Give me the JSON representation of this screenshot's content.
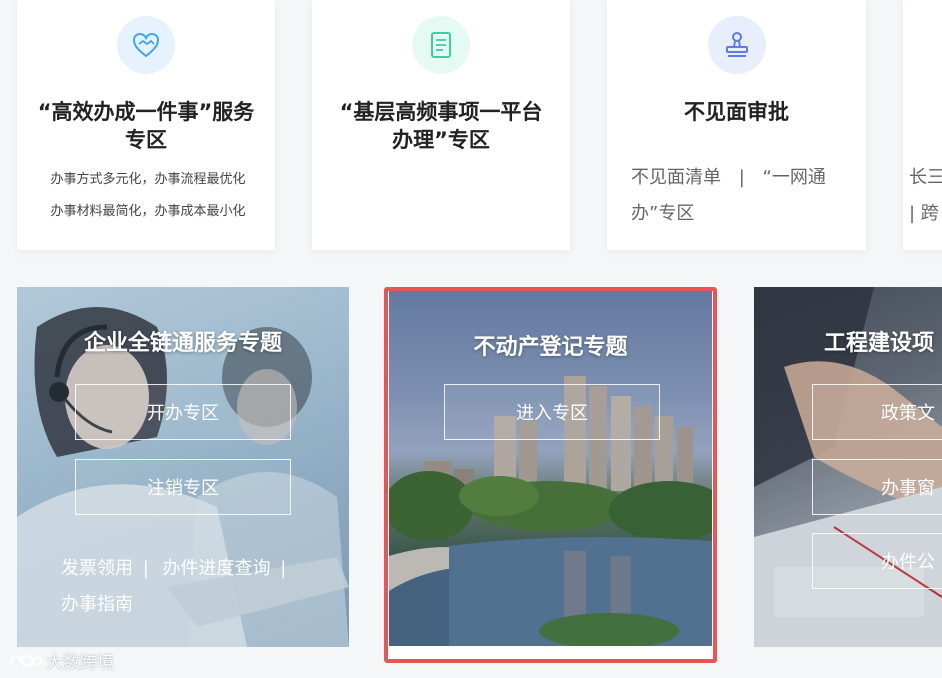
{
  "cards": [
    {
      "title": "“高效办成一件事”服务专区",
      "desc1": "办事方式多元化，办事流程最优化",
      "desc2": "办事材料最简化，办事成本最小化",
      "icon": "handshake-heart-icon"
    },
    {
      "title": "“基层高频事项一平台办理”专区",
      "icon": "document-icon"
    },
    {
      "title": "不见面审批",
      "link1": "不见面清单",
      "sep": "|",
      "link2": "“一网通办”专区",
      "icon": "stamp-icon"
    },
    {
      "line1": "长三",
      "line2": "| 跨"
    }
  ],
  "panels": [
    {
      "title": "企业全链通服务专题",
      "buttons": [
        "开办专区",
        "注销专区"
      ],
      "links": [
        "发票领用",
        "办件进度查询",
        "办事指南"
      ],
      "sep": "|"
    },
    {
      "title": "不动产登记专题",
      "buttons": [
        "进入专区"
      ]
    },
    {
      "title": "工程建设项",
      "buttons": [
        "政策文",
        "办事窗",
        "办件公"
      ]
    }
  ],
  "watermark": "大数跨境",
  "colors": {
    "highlight_border": "#e85555",
    "icon_blue_bg": "#e6f3ff",
    "icon_green_bg": "#e4faf3",
    "icon_indigo_bg": "#e8eefc"
  }
}
